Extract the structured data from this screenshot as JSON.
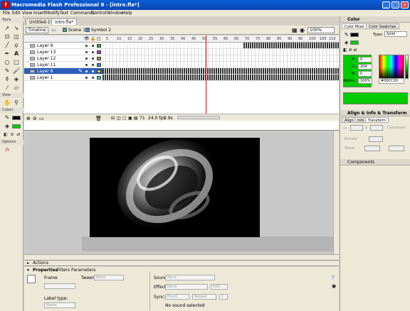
{
  "window": {
    "title": "Macromedia Flash Professional 8 - [intro.fla*]",
    "app_icon": "f"
  },
  "menu": [
    "File",
    "Edit",
    "View",
    "Insert",
    "Modify",
    "Text",
    "Commands",
    "Control",
    "Window",
    "Help"
  ],
  "tools": {
    "header": "Tools",
    "view_header": "View",
    "colors_header": "Colors",
    "options_header": "Options"
  },
  "doc_tabs": [
    "Untitled-1*",
    "intro.fla*"
  ],
  "editbar": {
    "timeline_label": "Timeline",
    "scene": "Scene 1",
    "symbol": "Symbol 2",
    "zoom": "100%"
  },
  "timeline": {
    "ruler": [
      "5",
      "10",
      "15",
      "20",
      "25",
      "30",
      "35",
      "40",
      "45",
      "50",
      "55",
      "60",
      "65",
      "70",
      "75",
      "80",
      "85",
      "90",
      "95",
      "100",
      "105",
      "110",
      "115"
    ],
    "layers": [
      "Layer 9",
      "Layer 13",
      "Layer 12",
      "Layer 11",
      "Layer 8",
      "Layer 1"
    ],
    "selected_layer": "Layer 8",
    "frame": "71",
    "fps": "24.0 fps",
    "elapsed": "2.9s"
  },
  "actions_label": "Actions",
  "properties": {
    "tabs": [
      "Properties",
      "Filters",
      "Parameters"
    ],
    "frame_label": "Frame",
    "tween_label": "Tween:",
    "tween_value": "None",
    "label_type": "Label type:",
    "label_type_value": "Name",
    "sound_label": "Sound:",
    "sound_value": "None",
    "effect_label": "Effect:",
    "effect_value": "None",
    "edit_label": "Edit...",
    "sync_label": "Sync:",
    "sync_value": "Event",
    "repeat_value": "Repeat",
    "repeat_count": "1",
    "no_sound": "No sound selected"
  },
  "color_panel": {
    "header": "Color",
    "tabs": [
      "Color Mixer",
      "Color Swatches"
    ],
    "type_label": "Type:",
    "type_value": "Solid",
    "r_label": "R:",
    "r_value": "0",
    "g_label": "G:",
    "g_value": "204",
    "b_label": "B:",
    "b_value": "0",
    "alpha_label": "Alpha:",
    "alpha_value": "100%",
    "hex": "#00CC00",
    "current_color": "#00cc00"
  },
  "align_panel": {
    "header": "Align & Info & Transform",
    "tabs": [
      "Align",
      "Info",
      "Transform"
    ],
    "constrain": "Constrain",
    "rotate": "Rotate",
    "skew": "Skew"
  },
  "components_header": "Components"
}
